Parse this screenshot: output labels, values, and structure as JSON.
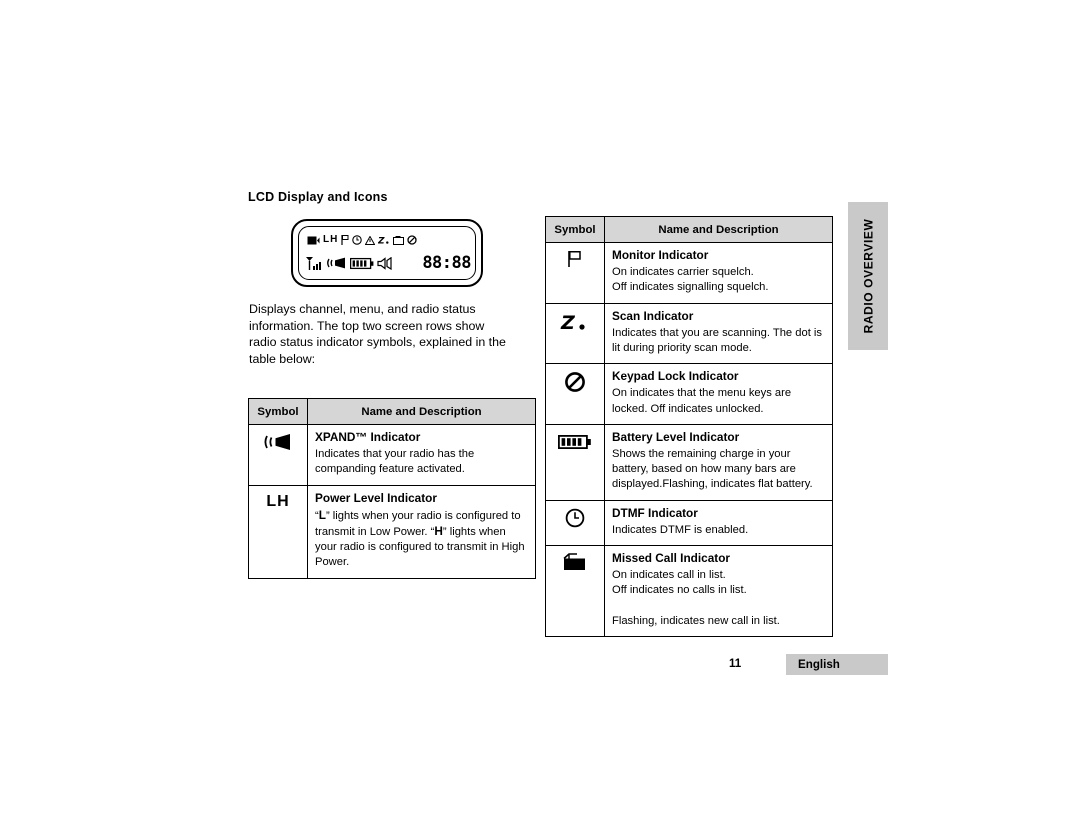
{
  "page": {
    "heading": "LCD Display and Icons",
    "body_text": "Displays channel, menu, and radio status information. The top two screen rows show radio status indicator symbols, explained in the table below:",
    "page_number": "11",
    "language_tab": "English",
    "side_tab": "RADIO OVERVIEW"
  },
  "lcd": {
    "segment_display": "88:88",
    "top_row_icons": [
      "message-icon",
      "power-level-lh-icon",
      "monitor-flag-icon",
      "dtmf-clock-icon",
      "warning-triangle-icon",
      "scan-z-icon",
      "missed-call-icon",
      "keypad-lock-icon"
    ],
    "bottom_row_icons": [
      "signal-bars-icon",
      "xpand-icon",
      "battery-icon",
      "speaker-icon"
    ],
    "power_level_text": "LH"
  },
  "left_table": {
    "headers": [
      "Symbol",
      "Name and Description"
    ],
    "rows": [
      {
        "symbol": "xpand-icon",
        "title": "XPAND™ Indicator",
        "description": "Indicates that your radio has the companding feature activated."
      },
      {
        "symbol": "power-level-lh-icon",
        "symbol_text": "LH",
        "title": "Power Level Indicator",
        "description": "“L” lights when your radio is configured to transmit in Low Power. “H” lights when your radio is configured to transmit in High Power.",
        "description_parts": [
          "“",
          "L",
          "” lights when your radio is configured to transmit in Low Power. “",
          "H",
          "” lights when your radio is configured to transmit in High Power."
        ]
      }
    ]
  },
  "right_table": {
    "headers": [
      "Symbol",
      "Name and Description"
    ],
    "rows": [
      {
        "symbol": "monitor-flag-icon",
        "title": "Monitor Indicator",
        "description": "On indicates carrier squelch.\nOff indicates signalling squelch."
      },
      {
        "symbol": "scan-z-icon",
        "title": "Scan Indicator",
        "description": "Indicates that you are scanning. The dot is lit during priority scan mode."
      },
      {
        "symbol": "keypad-lock-icon",
        "title": "Keypad Lock Indicator",
        "description": "On indicates that the menu keys are locked. Off indicates unlocked."
      },
      {
        "symbol": "battery-icon",
        "title": "Battery Level Indicator",
        "description": "Shows the remaining charge in your battery, based on how many bars are displayed.Flashing, indicates flat battery."
      },
      {
        "symbol": "dtmf-clock-icon",
        "title": "DTMF Indicator",
        "description": "Indicates DTMF is enabled."
      },
      {
        "symbol": "missed-call-icon",
        "title": "Missed Call Indicator",
        "description": "On indicates call in list.\nOff indicates no calls in list.\n\nFlashing, indicates new call in list."
      }
    ]
  },
  "colors": {
    "header_gray": "#d6d6d6",
    "tab_gray": "#c9c9c9",
    "text": "#000000"
  }
}
